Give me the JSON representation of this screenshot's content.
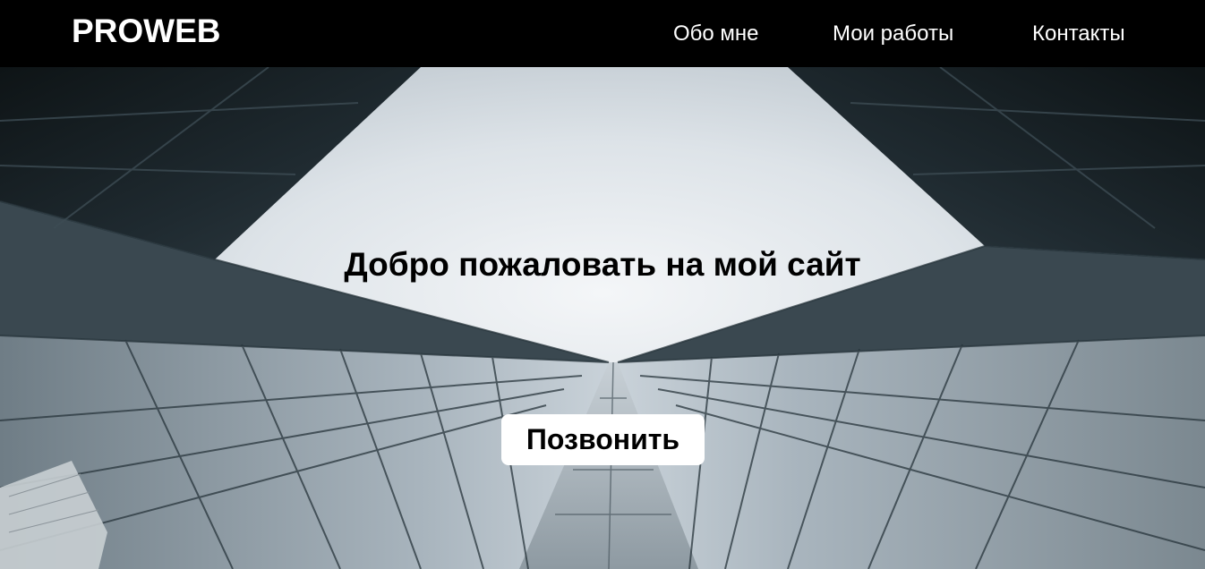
{
  "header": {
    "logo": "PROWEB",
    "nav": [
      {
        "label": "Обо мне"
      },
      {
        "label": "Мои работы"
      },
      {
        "label": "Контакты"
      }
    ]
  },
  "hero": {
    "title": "Добро пожаловать на мой сайт",
    "button_label": "Позвонить",
    "background": "glass-skyscrapers-looking-up"
  },
  "colors": {
    "header_bg": "#000000",
    "header_text": "#ffffff",
    "button_bg": "#ffffff",
    "text_dark": "#000000"
  }
}
